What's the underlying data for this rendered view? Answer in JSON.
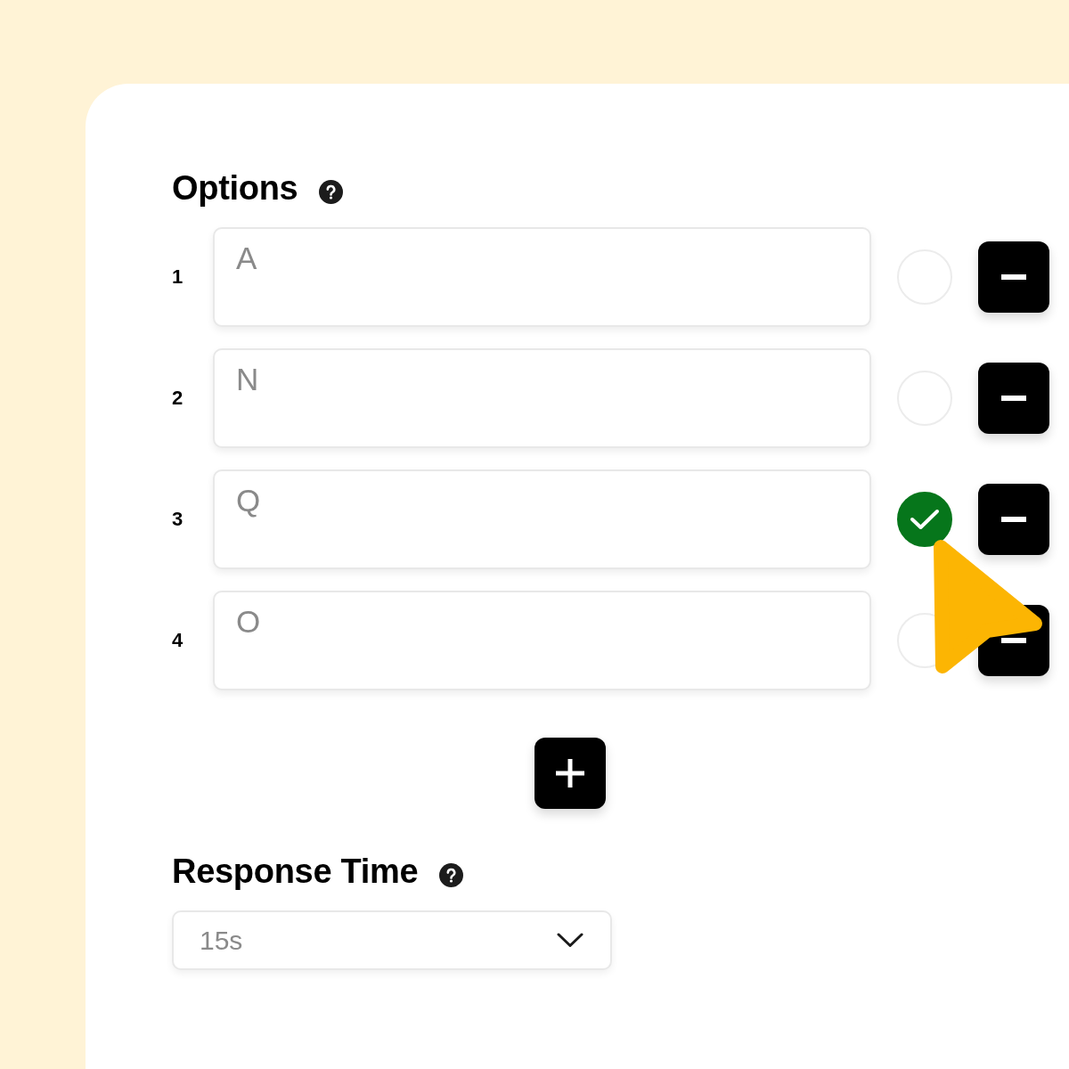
{
  "options": {
    "title": "Options",
    "items": [
      {
        "number": "1",
        "value": "A",
        "selected": false
      },
      {
        "number": "2",
        "value": "N",
        "selected": false
      },
      {
        "number": "3",
        "value": "Q",
        "selected": true
      },
      {
        "number": "4",
        "value": "O",
        "selected": false
      }
    ]
  },
  "response_time": {
    "title": "Response Time",
    "value": "15s"
  }
}
